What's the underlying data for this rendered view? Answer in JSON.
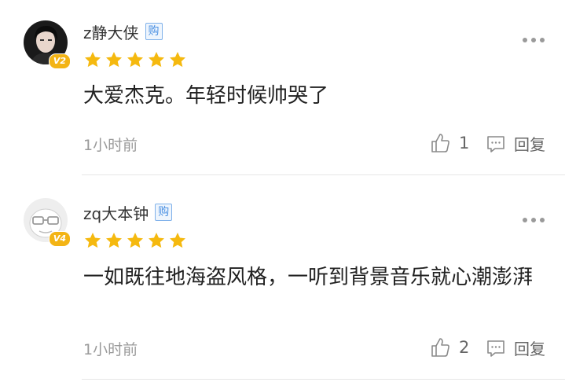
{
  "comments": [
    {
      "username": "z静大侠",
      "badge": "购",
      "level": "V2",
      "rating": 5,
      "text": "大爱杰克。年轻时候帅哭了",
      "time": "1小时前",
      "likes": "1",
      "reply_label": "回复"
    },
    {
      "username": "zq大本钟",
      "badge": "购",
      "level": "V4",
      "rating": 5,
      "text": "一如既往地海盗风格，一听到背景音乐就心潮澎湃",
      "time": "1小时前",
      "likes": "2",
      "reply_label": "回复"
    }
  ],
  "colors": {
    "star": "#f5b90f",
    "level_badge": "#f3b415",
    "badge_text": "#4a90e2"
  },
  "icons": {
    "more": "more-dots-icon",
    "like": "thumb-up-icon",
    "reply": "comment-bubble-icon",
    "star": "star-icon"
  }
}
